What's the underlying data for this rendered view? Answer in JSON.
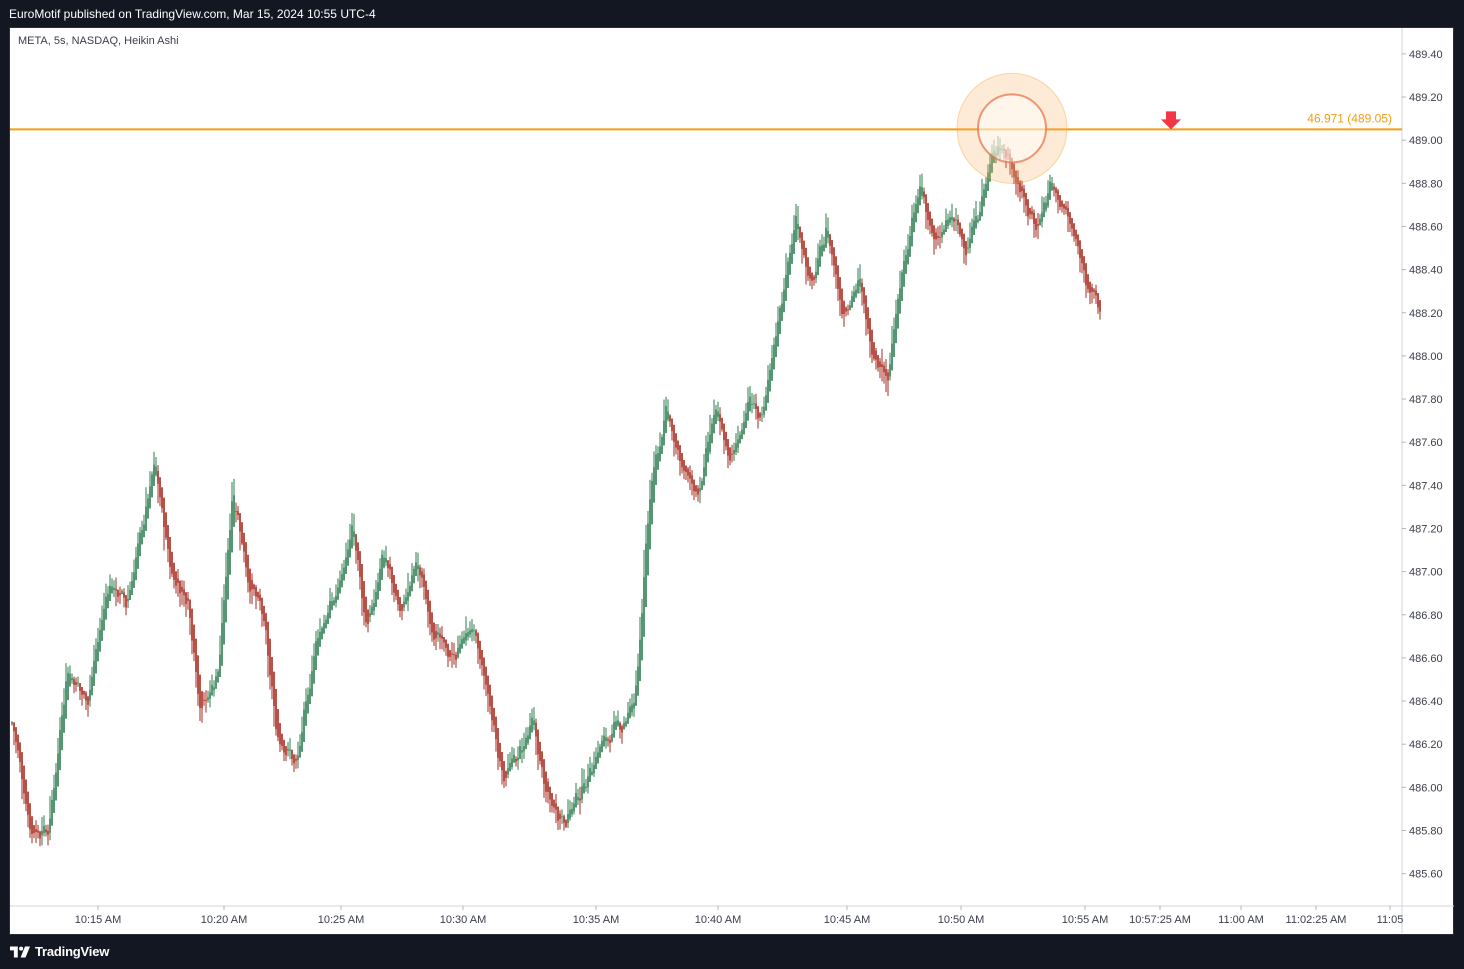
{
  "header": {
    "published": "EuroMotif published on TradingView.com, Mar 15, 2024 10:55 UTC-4"
  },
  "legend": {
    "symbol": "META, 5s, NASDAQ, Heikin Ashi"
  },
  "footer": {
    "brand": "TradingView"
  },
  "colors": {
    "up": "#2e7d4f",
    "down": "#a6281c",
    "level": "#f39c12",
    "arrow": "#f23645",
    "axis_text": "#3a3e4a"
  },
  "chart_data": {
    "type": "candlestick",
    "ylim": [
      485.45,
      489.52
    ],
    "y_ticks": [
      "489.40",
      "489.20",
      "489.00",
      "488.80",
      "488.60",
      "488.40",
      "488.20",
      "488.00",
      "487.80",
      "487.60",
      "487.40",
      "487.20",
      "487.00",
      "486.80",
      "486.60",
      "486.40",
      "486.20",
      "486.00",
      "485.80",
      "485.60"
    ],
    "x_ticks": [
      "10:15 AM",
      "10:20 AM",
      "10:25 AM",
      "10:30 AM",
      "10:35 AM",
      "10:40 AM",
      "10:45 AM",
      "10:50 AM",
      "10:55 AM",
      "10:57:25 AM",
      "11:00 AM",
      "11:02:25 AM",
      "11:05"
    ],
    "horizontal_line": {
      "value": 489.05,
      "label": "46.971 (489.05)"
    },
    "marker": {
      "type": "down-arrow"
    },
    "highlight": {
      "type": "circle-highlight"
    },
    "price_path": [
      [
        0,
        486.3
      ],
      [
        9,
        485.8
      ],
      [
        18,
        485.8
      ],
      [
        27,
        486.55
      ],
      [
        37,
        486.4
      ],
      [
        48,
        486.95
      ],
      [
        57,
        486.85
      ],
      [
        71,
        487.5
      ],
      [
        79,
        487.0
      ],
      [
        88,
        486.85
      ],
      [
        94,
        486.35
      ],
      [
        103,
        486.55
      ],
      [
        110,
        487.4
      ],
      [
        118,
        486.95
      ],
      [
        125,
        486.8
      ],
      [
        132,
        486.25
      ],
      [
        142,
        486.1
      ],
      [
        152,
        486.7
      ],
      [
        162,
        486.9
      ],
      [
        170,
        487.2
      ],
      [
        177,
        486.7
      ],
      [
        185,
        487.1
      ],
      [
        194,
        486.8
      ],
      [
        202,
        487.05
      ],
      [
        211,
        486.7
      ],
      [
        220,
        486.6
      ],
      [
        229,
        486.75
      ],
      [
        236,
        486.5
      ],
      [
        245,
        486.05
      ],
      [
        253,
        486.15
      ],
      [
        260,
        486.3
      ],
      [
        267,
        485.95
      ],
      [
        276,
        485.85
      ],
      [
        285,
        486.0
      ],
      [
        294,
        486.2
      ],
      [
        305,
        486.3
      ],
      [
        311,
        486.4
      ],
      [
        319,
        487.4
      ],
      [
        327,
        487.75
      ],
      [
        336,
        487.45
      ],
      [
        343,
        487.35
      ],
      [
        351,
        487.75
      ],
      [
        359,
        487.5
      ],
      [
        368,
        487.8
      ],
      [
        375,
        487.7
      ],
      [
        383,
        488.2
      ],
      [
        392,
        488.65
      ],
      [
        399,
        488.3
      ],
      [
        407,
        488.6
      ],
      [
        415,
        488.2
      ],
      [
        423,
        488.35
      ],
      [
        429,
        488.05
      ],
      [
        437,
        487.9
      ],
      [
        445,
        488.4
      ],
      [
        454,
        488.8
      ],
      [
        461,
        488.5
      ],
      [
        469,
        488.65
      ],
      [
        477,
        488.5
      ],
      [
        485,
        488.75
      ],
      [
        492,
        489.0
      ],
      [
        499,
        488.9
      ],
      [
        506,
        488.7
      ],
      [
        512,
        488.6
      ],
      [
        519,
        488.8
      ],
      [
        527,
        488.65
      ],
      [
        534,
        488.45
      ],
      [
        539,
        488.3
      ],
      [
        544,
        488.2
      ]
    ]
  }
}
